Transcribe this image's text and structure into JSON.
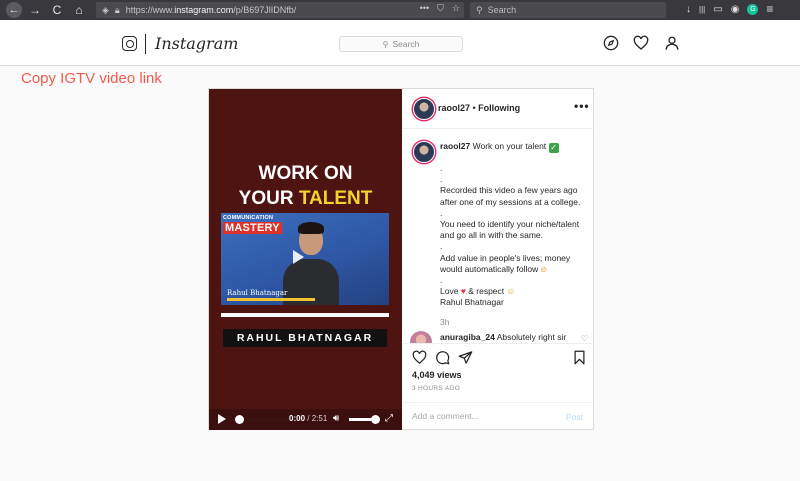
{
  "browser": {
    "url_prefix": "https://www.",
    "url_domain": "instagram.com",
    "url_path": "/p/B697JlIDNfb/",
    "url_menu": "•••",
    "search_placeholder": "Search",
    "nav_back": "←",
    "nav_forward": "→",
    "nav_reload": "C",
    "nav_home": "⌂",
    "right_icons": [
      "↓",
      "|||",
      "▭",
      "◉"
    ],
    "menu": "≡",
    "grammarly": "G"
  },
  "instagram": {
    "wordmark": "Instagram",
    "search_placeholder": "Search"
  },
  "overlay_label": "Copy IGTV video link",
  "video": {
    "title_line1": "WORK ON",
    "title_line2_plain": "YOUR ",
    "title_line2_accent": "TALENT",
    "badge_top": "COMMUNICATION",
    "badge_main": "MASTERY",
    "thumb_name": "Rahul Bhatnagar",
    "name_box": "RAHUL BHATNAGAR",
    "time_current": "0:00",
    "time_duration": "/ 2:51",
    "progress": 0.0,
    "volume": 0.85,
    "accent_color": "#f7d12c",
    "background_color": "#4e1412"
  },
  "post": {
    "username": "raool27",
    "follow_sep": " • ",
    "following": "Following",
    "more": "•••",
    "caption_user": "raool27",
    "caption_lines": [
      "Work on your talent",
      ".",
      ".",
      "Recorded this video a few years ago",
      "after one of my sessions at a college.",
      ".",
      "You need to identify your niche/talent",
      "and go all in with the same.",
      ".",
      "Add value in people's lives; money",
      "would automatically follow",
      ".",
      "Love",
      "& respect",
      "Rahul Bhatnagar"
    ],
    "caption_time": "3h",
    "comment_user": "anuragiba_24",
    "comment_text": "Absolutely right sir",
    "views": "4,049 views",
    "ago": "3 HOURS AGO",
    "add_comment_placeholder": "Add a comment...",
    "post_button": "Post"
  }
}
